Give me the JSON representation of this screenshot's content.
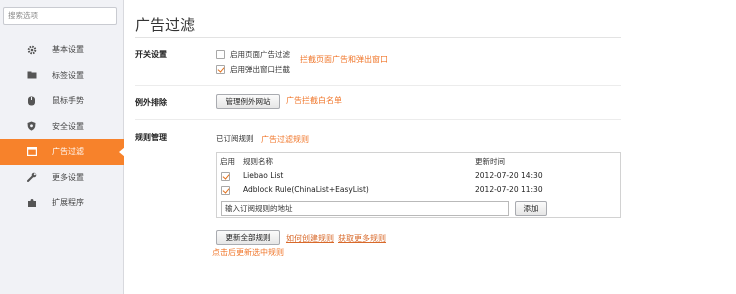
{
  "sidebar": {
    "search_placeholder": "搜索选项",
    "items": [
      {
        "label": "基本设置",
        "icon": "gear-icon"
      },
      {
        "label": "标签设置",
        "icon": "tab-icon"
      },
      {
        "label": "鼠标手势",
        "icon": "mouse-icon"
      },
      {
        "label": "安全设置",
        "icon": "shield-icon"
      },
      {
        "label": "广告过滤",
        "icon": "window-icon",
        "active": true
      },
      {
        "label": "更多设置",
        "icon": "wrench-icon"
      },
      {
        "label": "扩展程序",
        "icon": "puzzle-icon"
      }
    ]
  },
  "main": {
    "title": "广告过滤",
    "switch_section": {
      "label": "开关设置",
      "options": [
        {
          "label": "启用页面广告过滤",
          "checked": false
        },
        {
          "label": "启用弹出窗口拦截",
          "checked": true
        }
      ],
      "note": "拦截页面广告和弹出窗口"
    },
    "exception_section": {
      "label": "例外排除",
      "button": "管理例外网站",
      "note": "广告拦截白名单"
    },
    "rules_section": {
      "label": "规则管理",
      "subscribed_label": "已订阅规则",
      "note": "广告过滤规则",
      "columns": {
        "enable": "启用",
        "name": "规则名称",
        "updated": "更新时间"
      },
      "rules": [
        {
          "name": "Liebao List",
          "updated": "2012-07-20 14:30",
          "checked": true
        },
        {
          "name": "Adblock Rule(ChinaList+EasyList)",
          "updated": "2012-07-20 11:30",
          "checked": true
        }
      ],
      "url_input_value": "输入订阅规则的地址",
      "add_button": "添加",
      "update_all_button": "更新全部规则",
      "link_create": "如何创建规则",
      "link_more": "获取更多规则",
      "bottom_note": "点击后更新选中规则"
    }
  },
  "colors": {
    "accent": "#f7822b",
    "note": "#f0762a",
    "sidebar_bg": "#f1f2f6"
  }
}
